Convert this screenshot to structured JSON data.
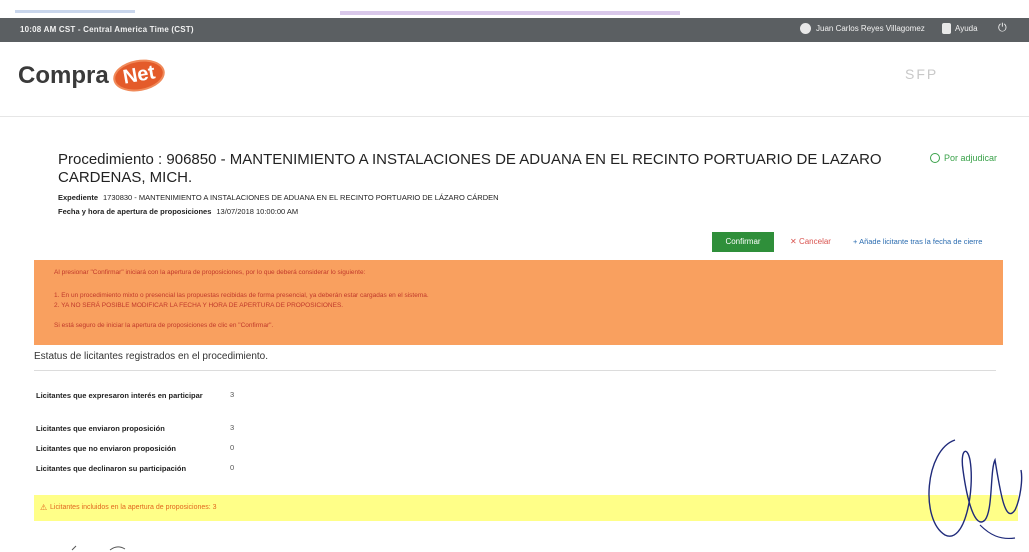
{
  "topbar": {
    "time": "10:08 AM CST - Central America Time (CST)",
    "user": "Juan Carlos Reyes Villagomez",
    "help": "Ayuda",
    "power_glyph": "⏻"
  },
  "header": {
    "logo_text": "Compra",
    "logo_badge": "Net",
    "org_mark": "SFP"
  },
  "procedure": {
    "title": "Procedimiento : 906850 - MANTENIMIENTO A INSTALACIONES DE ADUANA EN EL RECINTO PORTUARIO DE LAZARO CARDENAS, MICH.",
    "status": "Por adjudicar",
    "expediente_label": "Expediente",
    "expediente_value": "1730830 - MANTENIMIENTO A INSTALACIONES DE ADUANA EN EL RECINTO PORTUARIO DE LÁZARO CÁRDEN",
    "apertura_label": "Fecha y hora de apertura de proposiciones",
    "apertura_value": "13/07/2018 10:00:00 AM"
  },
  "actions": {
    "confirm": "Confirmar",
    "cancel": "Cancelar",
    "add_bidder": "Añade licitante tras la fecha de cierre"
  },
  "alert": {
    "line1": "Al presionar \"Confirmar\" iniciará con la apertura de proposiciones, por lo que deberá considerar lo siguiente:",
    "line2": "1. En un procedimiento mixto o presencial las propuestas recibidas de forma presencial, ya deberán estar cargadas en el sistema.",
    "line3": "2. YA NO SERÁ POSIBLE MODIFICAR LA FECHA Y HORA DE APERTURA DE PROPOSICIONES.",
    "line4": "Si está seguro de iniciar la apertura de proposiciones de clic en \"Confirmar\"."
  },
  "bidders": {
    "heading": "Estatus de licitantes registrados en el procedimiento.",
    "rows": [
      {
        "label": "Licitantes que expresaron interés en participar",
        "value": "3"
      },
      {
        "label": "Licitantes que enviaron proposición",
        "value": "3"
      },
      {
        "label": "Licitantes que no enviaron proposición",
        "value": "0"
      },
      {
        "label": "Licitantes que declinaron su participación",
        "value": "0"
      }
    ]
  },
  "note": {
    "icon": "warning-icon",
    "text": "Licitantes incluidos en la apertura de proposiciones: 3"
  },
  "colors": {
    "topbar": "#5b5f62",
    "confirm": "#2f8f3a",
    "alert_bg": "#f9a05f",
    "note_bg": "#ffff88",
    "status": "#3aa24a"
  }
}
